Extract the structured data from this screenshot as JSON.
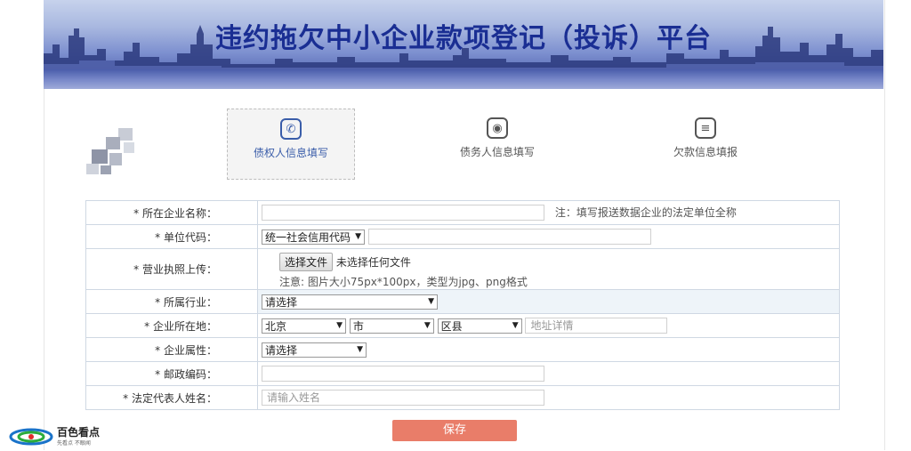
{
  "banner": {
    "title": "违约拖欠中小企业款项登记（投诉）平台"
  },
  "steps": [
    {
      "label": "债权人信息填写",
      "icon": "phone-icon",
      "active": true
    },
    {
      "label": "债务人信息填写",
      "icon": "medal-icon",
      "active": false
    },
    {
      "label": "欠款信息填报",
      "icon": "list-icon",
      "active": false
    }
  ],
  "form": {
    "company_name": {
      "label": "* 所在企业名称：",
      "value": "",
      "note": "注：填写报送数据企业的法定单位全称"
    },
    "unit_code": {
      "label": "* 单位代码：",
      "select": "统一社会信用代码",
      "value": ""
    },
    "license": {
      "label": "* 营业执照上传：",
      "button": "选择文件",
      "status": "未选择任何文件",
      "hint": "注意: 图片大小75px*100px，类型为jpg、png格式"
    },
    "industry": {
      "label": "* 所属行业：",
      "select": "请选择"
    },
    "location": {
      "label": "* 企业所在地：",
      "province": "北京",
      "city": "市",
      "district": "区县",
      "address_placeholder": "地址详情"
    },
    "nature": {
      "label": "* 企业属性：",
      "select": "请选择"
    },
    "postcode": {
      "label": "* 邮政编码：",
      "value": ""
    },
    "legal_rep": {
      "label": "* 法定代表人姓名：",
      "placeholder": "请输入姓名"
    }
  },
  "save_label": "保存",
  "watermark": {
    "name": "百色看点",
    "slogan": "先看点 不眼闻"
  },
  "colors": {
    "title": "#1a2e93",
    "save": "#e97d69",
    "active_step": "#3a5da9",
    "border": "#cfd8e3"
  }
}
